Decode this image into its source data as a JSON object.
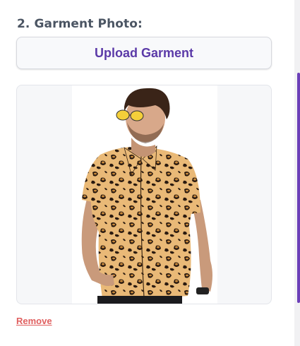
{
  "garment": {
    "label": "2. Garment Photo:",
    "upload_label": "Upload Garment",
    "remove_label": "Remove"
  },
  "colors": {
    "accent": "#5b3aa8",
    "remove": "#e06060",
    "scroll_thumb": "#6b3fb8"
  },
  "preview": {
    "image": "man-in-leopard-print-shirt"
  }
}
